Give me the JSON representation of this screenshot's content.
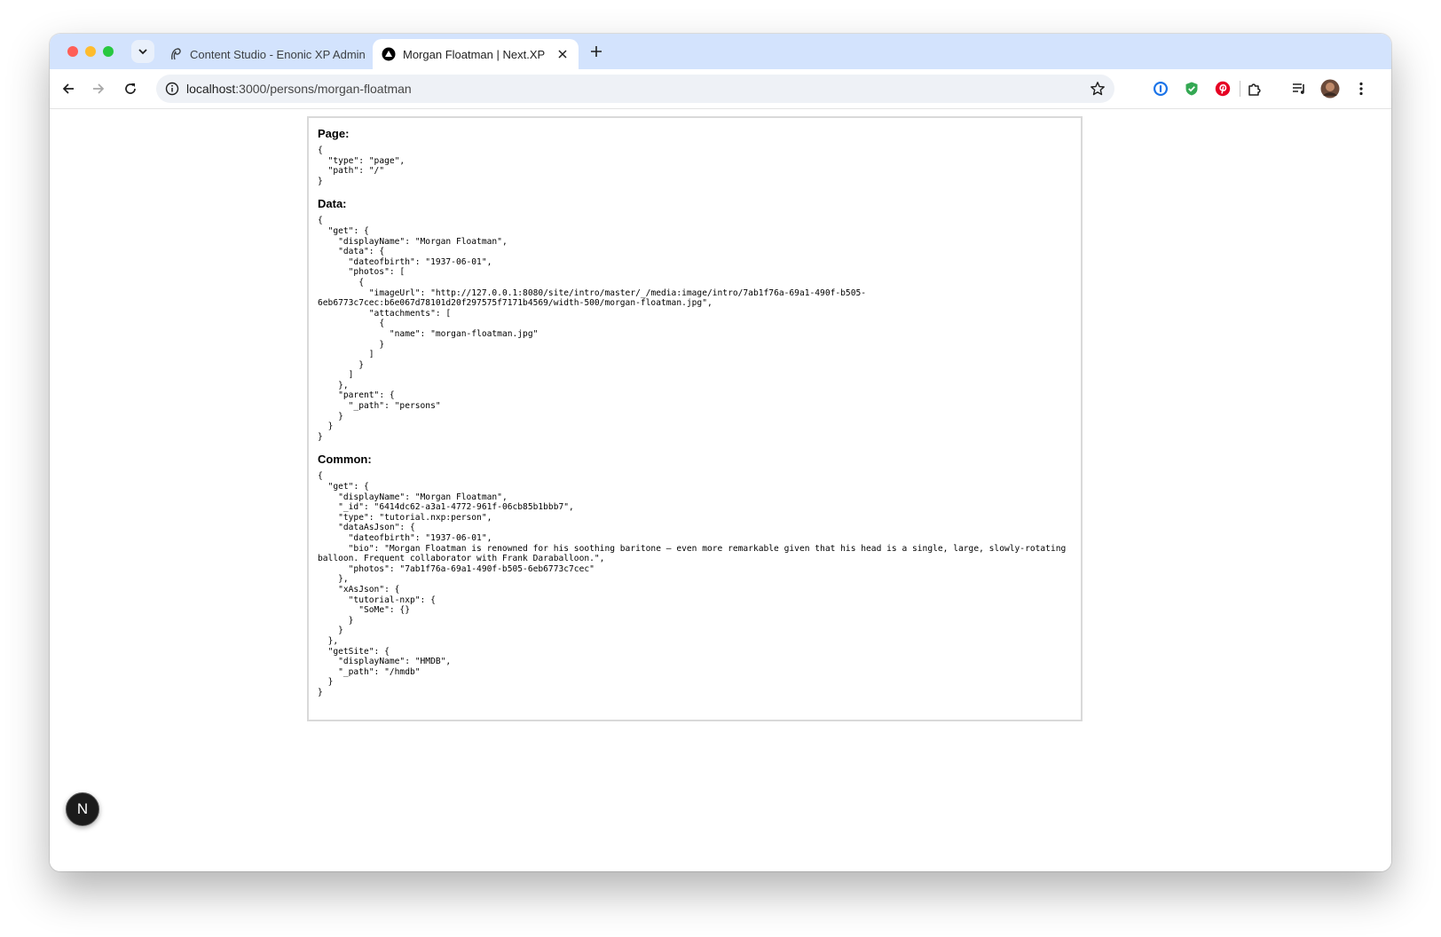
{
  "browser": {
    "tabs": [
      {
        "title": "Content Studio - Enonic XP Admin",
        "icon": "enonic-icon",
        "active": false
      },
      {
        "title": "Morgan Floatman | Next.XP",
        "icon": "nextjs-icon",
        "active": true
      }
    ],
    "url": {
      "host": "localhost",
      "rest": ":3000/persons/morgan-floatman"
    },
    "extensions": [
      "1password-icon",
      "shield-check-icon",
      "pinterest-icon",
      "puzzle-extensions-icon",
      "reading-list-icon",
      "profile-avatar",
      "more-menu-icon"
    ]
  },
  "page": {
    "sections": [
      {
        "heading": "Page:",
        "json": "{\n  \"type\": \"page\",\n  \"path\": \"/\"\n}"
      },
      {
        "heading": "Data:",
        "json": "{\n  \"get\": {\n    \"displayName\": \"Morgan Floatman\",\n    \"data\": {\n      \"dateofbirth\": \"1937-06-01\",\n      \"photos\": [\n        {\n          \"imageUrl\": \"http://127.0.0.1:8080/site/intro/master/_/media:image/intro/7ab1f76a-69a1-490f-b505-6eb6773c7cec:b6e067d78101d20f297575f7171b4569/width-500/morgan-floatman.jpg\",\n          \"attachments\": [\n            {\n              \"name\": \"morgan-floatman.jpg\"\n            }\n          ]\n        }\n      ]\n    },\n    \"parent\": {\n      \"_path\": \"persons\"\n    }\n  }\n}"
      },
      {
        "heading": "Common:",
        "json": "{\n  \"get\": {\n    \"displayName\": \"Morgan Floatman\",\n    \"_id\": \"6414dc62-a3a1-4772-961f-06cb85b1bbb7\",\n    \"type\": \"tutorial.nxp:person\",\n    \"dataAsJson\": {\n      \"dateofbirth\": \"1937-06-01\",\n      \"bio\": \"Morgan Floatman is renowned for his soothing baritone – even more remarkable given that his head is a single, large, slowly-rotating balloon. Frequent collaborator with Frank Daraballoon.\",\n      \"photos\": \"7ab1f76a-69a1-490f-b505-6eb6773c7cec\"\n    },\n    \"xAsJson\": {\n      \"tutorial-nxp\": {\n        \"SoMe\": {}\n      }\n    }\n  },\n  \"getSite\": {\n    \"displayName\": \"HMDB\",\n    \"_path\": \"/hmdb\"\n  }\n}"
      }
    ]
  },
  "badge": {
    "label": "N"
  }
}
